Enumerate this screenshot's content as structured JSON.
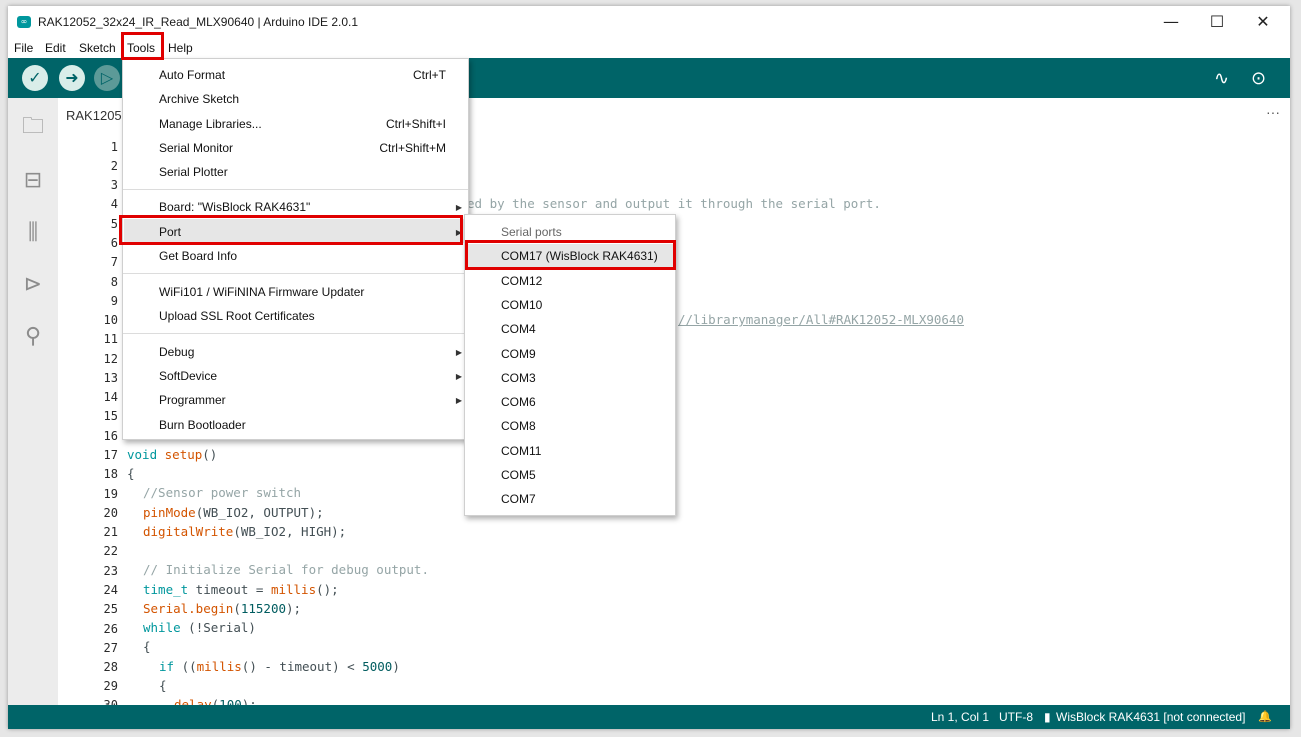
{
  "window": {
    "title": "RAK12052_32x24_IR_Read_MLX90640 | Arduino IDE 2.0.1",
    "app_icon": "∞",
    "controls": {
      "minimize": "—",
      "maximize": "☐",
      "close": "✕"
    }
  },
  "menubar": [
    "File",
    "Edit",
    "Sketch",
    "Tools",
    "Help"
  ],
  "editor": {
    "tab_label": "RAK1205",
    "more_label": "···",
    "line_numbers": [
      "1",
      "2",
      "3",
      "4",
      "5",
      "6",
      "7",
      "8",
      "9",
      "10",
      "11",
      "12",
      "13",
      "14",
      "15",
      "16",
      "17",
      "18",
      "19",
      "20",
      "21",
      "22",
      "23",
      "24",
      "25",
      "26",
      "27",
      "28",
      "29",
      "30"
    ],
    "visible_fragments": {
      "line4_tail": "ed by the sensor and output it through the serial port.",
      "line10_tail": "//librarymanager/All#RAK12052-MLX90640"
    },
    "code": {
      "l17_kw": "void",
      "l17_fn": "setup",
      "l17_rest": "()",
      "l18": "{",
      "l19": "//Sensor power switch",
      "l20_fn": "pinMode",
      "l20_rest": "(WB_IO2, OUTPUT);",
      "l21_fn": "digitalWrite",
      "l21_rest": "(WB_IO2, HIGH);",
      "l23": "// Initialize Serial for debug output.",
      "l24_kw": "time_t",
      "l24_mid": " timeout = ",
      "l24_fn": "millis",
      "l24_rest": "();",
      "l25_kw": "Serial",
      "l25_fn": ".begin",
      "l25_open": "(",
      "l25_num": "115200",
      "l25_rest": ");",
      "l26_kw": "while",
      "l26_rest": " (!Serial)",
      "l27": "{",
      "l28_kw": "if",
      "l28_open": " ((",
      "l28_fn": "millis",
      "l28_mid": "() - timeout) < ",
      "l28_num": "5000",
      "l28_close": ")",
      "l29": "{",
      "l30_fn": "delay",
      "l30_open": "(",
      "l30_num": "100",
      "l30_rest": ");"
    }
  },
  "tools_menu": {
    "items": [
      {
        "label": "Auto Format",
        "shortcut": "Ctrl+T"
      },
      {
        "label": "Archive Sketch",
        "shortcut": ""
      },
      {
        "label": "Manage Libraries...",
        "shortcut": "Ctrl+Shift+I"
      },
      {
        "label": "Serial Monitor",
        "shortcut": "Ctrl+Shift+M"
      },
      {
        "label": "Serial Plotter",
        "shortcut": ""
      },
      {
        "label": "Board: \"WisBlock RAK4631\"",
        "shortcut": ""
      },
      {
        "label": "Port",
        "shortcut": ""
      },
      {
        "label": "Get Board Info",
        "shortcut": ""
      },
      {
        "label": "WiFi101 / WiFiNINA Firmware Updater",
        "shortcut": ""
      },
      {
        "label": "Upload SSL Root Certificates",
        "shortcut": ""
      },
      {
        "label": "Debug",
        "shortcut": ""
      },
      {
        "label": "SoftDevice",
        "shortcut": ""
      },
      {
        "label": "Programmer",
        "shortcut": ""
      },
      {
        "label": "Burn Bootloader",
        "shortcut": ""
      }
    ],
    "submenu_arrow": "▶"
  },
  "port_submenu": {
    "header": "Serial ports",
    "ports": [
      "COM17 (WisBlock RAK4631)",
      "COM12",
      "COM10",
      "COM4",
      "COM9",
      "COM3",
      "COM6",
      "COM8",
      "COM11",
      "COM5",
      "COM7"
    ]
  },
  "statusbar": {
    "position": "Ln 1, Col 1",
    "encoding": "UTF-8",
    "board": "WisBlock RAK4631 [not connected]",
    "board_icon": "▮",
    "bell_icon": "🔔"
  },
  "colors": {
    "toolbar": "#006468",
    "highlight_box": "#e00000",
    "keyword": "#00979d",
    "function": "#d35400",
    "comment": "#95a5a6"
  }
}
